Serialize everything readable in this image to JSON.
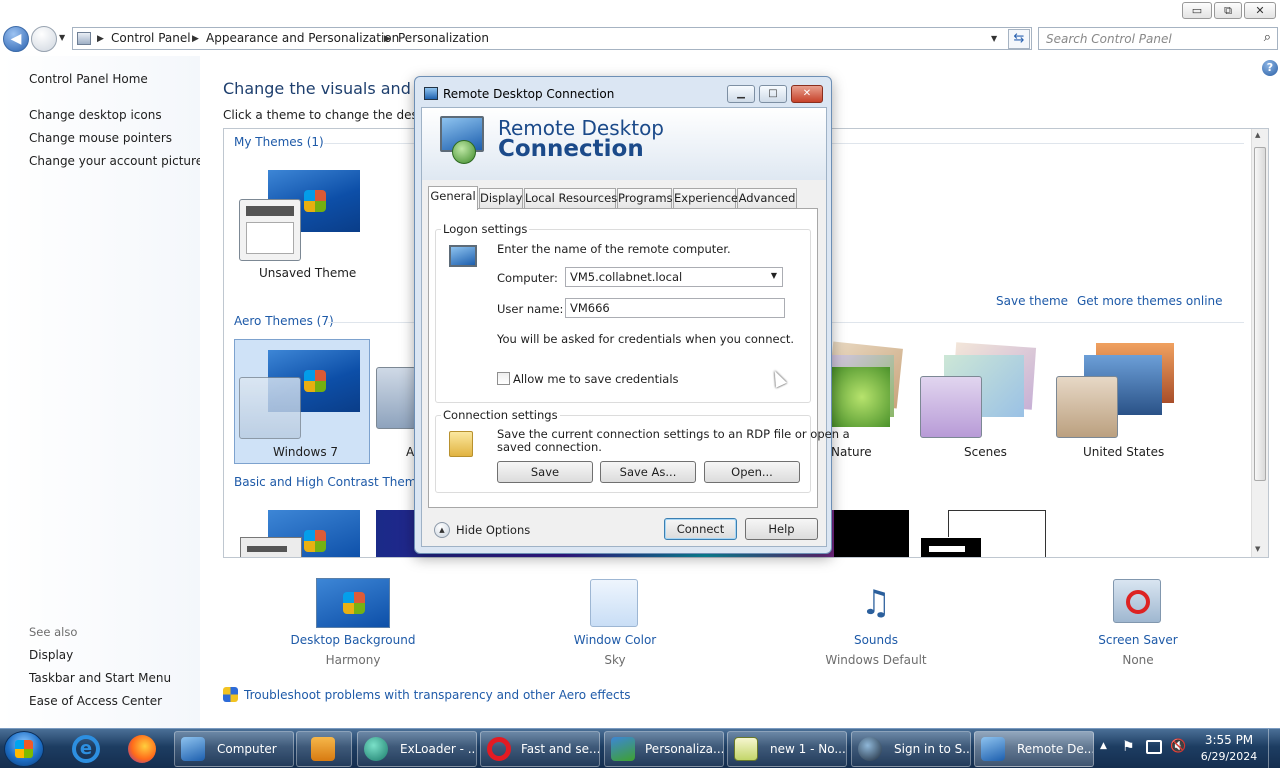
{
  "window": {
    "minimize": "▭",
    "restore": "⧉",
    "close": "✕"
  },
  "address": {
    "breadcrumbs": [
      "Control Panel",
      "Appearance and Personalization",
      "Personalization"
    ],
    "search_placeholder": "Search Control Panel"
  },
  "sidebar": {
    "home": "Control Panel Home",
    "links": [
      "Change desktop icons",
      "Change mouse pointers",
      "Change your account picture"
    ],
    "see_also_title": "See also",
    "see_also": [
      "Display",
      "Taskbar and Start Menu",
      "Ease of Access Center"
    ]
  },
  "main": {
    "heading": "Change the visuals and sou",
    "subheading": "Click a theme to change the desktop",
    "save_theme": "Save theme",
    "get_more": "Get more themes online",
    "my_themes": "My Themes (1)",
    "aero_themes": "Aero Themes (7)",
    "basic_themes": "Basic and High Contrast Themes (",
    "themes": {
      "unsaved": "Unsaved Theme",
      "windows7": "Windows 7",
      "a_partial": "A",
      "nature": "Nature",
      "scenes": "Scenes",
      "united_states": "United States"
    },
    "features": [
      {
        "title": "Desktop Background",
        "value": "Harmony"
      },
      {
        "title": "Window Color",
        "value": "Sky"
      },
      {
        "title": "Sounds",
        "value": "Windows Default"
      },
      {
        "title": "Screen Saver",
        "value": "None"
      }
    ],
    "troubleshoot": "Troubleshoot problems with transparency and other Aero effects"
  },
  "rdp": {
    "title": "Remote Desktop Connection",
    "banner_line1": "Remote Desktop",
    "banner_line2": "Connection",
    "tabs": [
      "General",
      "Display",
      "Local Resources",
      "Programs",
      "Experience",
      "Advanced"
    ],
    "logon_settings": "Logon settings",
    "enter_name": "Enter the name of the remote computer.",
    "computer_label": "Computer:",
    "computer_value": "VM5.collabnet.local",
    "username_label": "User name:",
    "username_value": "VM666",
    "credentials_note": "You will be asked for credentials when you connect.",
    "allow_save": "Allow me to save credentials",
    "connection_settings": "Connection settings",
    "conn_desc_line1": "Save the current connection settings to an RDP file or open a",
    "conn_desc_line2": "saved connection.",
    "save_btn": "Save",
    "save_as_btn": "Save As...",
    "open_btn": "Open...",
    "hide_options": "Hide Options",
    "connect_btn": "Connect",
    "help_btn": "Help"
  },
  "taskbar": {
    "items": [
      "Computer",
      "ExLoader - ...",
      "Fast and se...",
      "Personaliza...",
      "new 1 - No...",
      "Sign in to S...",
      "Remote De..."
    ],
    "time": "3:55 PM",
    "date": "6/29/2024"
  }
}
